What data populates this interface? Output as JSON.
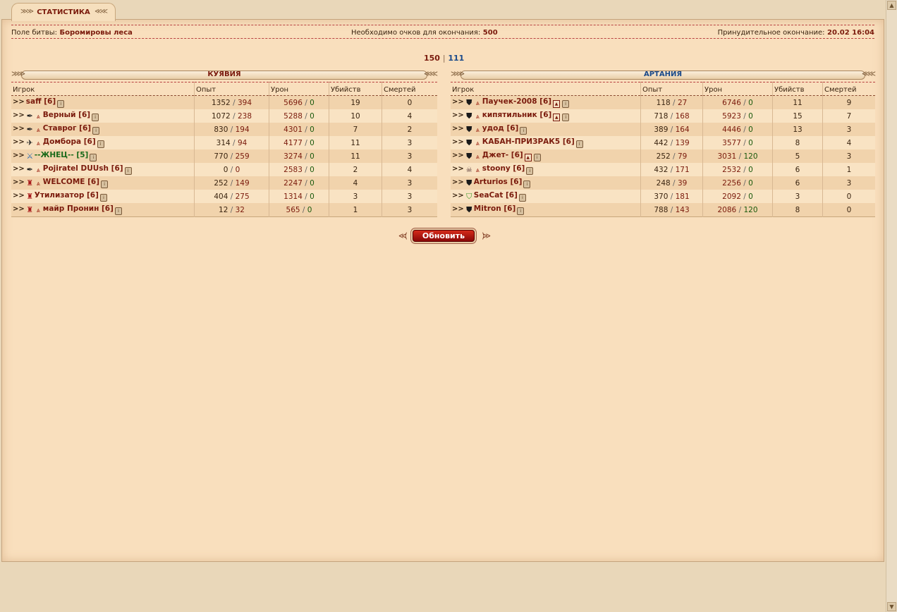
{
  "tab": {
    "label": "СТАТИСТИКА"
  },
  "info": {
    "battlefield_label": "Поле битвы:",
    "battlefield_value": "Боромировы леса",
    "points_label": "Необходимо очков для окончания:",
    "points_value": "500",
    "forced_end_label": "Принудительное окончание:",
    "forced_end_value": "20.02 16:04"
  },
  "score": {
    "left": "150",
    "sep": "|",
    "right": "111"
  },
  "columns": {
    "player": "Игрок",
    "exp": "Опыт",
    "damage": "Урон",
    "kills": "Убийств",
    "deaths": "Смертей"
  },
  "teams": [
    {
      "name": "КУЯВИЯ",
      "color": "#7a1a0c",
      "rows": [
        {
          "icons": [],
          "name": "saff [6]",
          "exp_a": "1352",
          "exp_b": "394",
          "dmg_a": "5696",
          "dmg_b": "0",
          "kills": "19",
          "deaths": "0"
        },
        {
          "icons": [
            "pen-icon",
            "rank-icon"
          ],
          "name": "Верный [6]",
          "exp_a": "1072",
          "exp_b": "238",
          "dmg_a": "5288",
          "dmg_b": "0",
          "kills": "10",
          "deaths": "4"
        },
        {
          "icons": [
            "pen-icon",
            "rank-icon"
          ],
          "name": "Ставрог [6]",
          "exp_a": "830",
          "exp_b": "194",
          "dmg_a": "4301",
          "dmg_b": "0",
          "kills": "7",
          "deaths": "2"
        },
        {
          "icons": [
            "bird-icon",
            "rank-icon"
          ],
          "name": "Домбора [6]",
          "exp_a": "314",
          "exp_b": "94",
          "dmg_a": "4177",
          "dmg_b": "0",
          "kills": "11",
          "deaths": "3"
        },
        {
          "icons": [
            "crossed-swords-icon"
          ],
          "name": "--ЖНЕЦ-- [5]",
          "green": true,
          "exp_a": "770",
          "exp_b": "259",
          "dmg_a": "3274",
          "dmg_b": "0",
          "kills": "11",
          "deaths": "3"
        },
        {
          "icons": [
            "pen-icon",
            "rank-icon"
          ],
          "name": "Pojiratel DUUsh [6]",
          "exp_a": "0",
          "exp_b": "0",
          "dmg_a": "2583",
          "dmg_b": "0",
          "kills": "2",
          "deaths": "4"
        },
        {
          "icons": [
            "helmet-icon",
            "rank-icon"
          ],
          "name": "WELCOME [6]",
          "exp_a": "252",
          "exp_b": "149",
          "dmg_a": "2247",
          "dmg_b": "0",
          "kills": "4",
          "deaths": "3"
        },
        {
          "icons": [
            "helmet-icon"
          ],
          "name": "Утилизатор [6]",
          "exp_a": "404",
          "exp_b": "275",
          "dmg_a": "1314",
          "dmg_b": "0",
          "kills": "3",
          "deaths": "3"
        },
        {
          "icons": [
            "helmet-icon",
            "rank-icon"
          ],
          "name": "майр Пронин [6]",
          "exp_a": "12",
          "exp_b": "32",
          "dmg_a": "565",
          "dmg_b": "0",
          "kills": "1",
          "deaths": "3"
        }
      ]
    },
    {
      "name": "АРТАНИЯ",
      "color": "#1a4a8a",
      "rows": [
        {
          "icons": [
            "shield-icon",
            "rank-icon"
          ],
          "name": "Паучек-2008 [6]",
          "flag": true,
          "exp_a": "118",
          "exp_b": "27",
          "dmg_a": "6746",
          "dmg_b": "0",
          "kills": "11",
          "deaths": "9"
        },
        {
          "icons": [
            "shield-icon",
            "rank-icon"
          ],
          "name": "кипятильник [6]",
          "flag": true,
          "exp_a": "718",
          "exp_b": "168",
          "dmg_a": "5923",
          "dmg_b": "0",
          "kills": "15",
          "deaths": "7"
        },
        {
          "icons": [
            "shield-icon",
            "rank-icon"
          ],
          "name": "удод [6]",
          "exp_a": "389",
          "exp_b": "164",
          "dmg_a": "4446",
          "dmg_b": "0",
          "kills": "13",
          "deaths": "3"
        },
        {
          "icons": [
            "shield-icon",
            "rank-icon"
          ],
          "name": "КАБАН-ПРИЗРАК5 [6]",
          "exp_a": "442",
          "exp_b": "139",
          "dmg_a": "3577",
          "dmg_b": "0",
          "kills": "8",
          "deaths": "4"
        },
        {
          "icons": [
            "shield-icon",
            "rank-icon"
          ],
          "name": "Джет- [6]",
          "flag": true,
          "exp_a": "252",
          "exp_b": "79",
          "dmg_a": "3031",
          "dmg_b": "120",
          "kills": "5",
          "deaths": "3"
        },
        {
          "icons": [
            "skull-icon",
            "rank-icon"
          ],
          "name": "stoony [6]",
          "exp_a": "432",
          "exp_b": "171",
          "dmg_a": "2532",
          "dmg_b": "0",
          "kills": "6",
          "deaths": "1"
        },
        {
          "icons": [
            "shield-icon"
          ],
          "name": "Arturios [6]",
          "exp_a": "248",
          "exp_b": "39",
          "dmg_a": "2256",
          "dmg_b": "0",
          "kills": "6",
          "deaths": "3"
        },
        {
          "icons": [
            "green-shield-icon"
          ],
          "name": "SeaCat [6]",
          "exp_a": "370",
          "exp_b": "181",
          "dmg_a": "2092",
          "dmg_b": "0",
          "kills": "3",
          "deaths": "0"
        },
        {
          "icons": [
            "shield-icon"
          ],
          "name": "Mitron [6]",
          "exp_a": "788",
          "exp_b": "143",
          "dmg_a": "2086",
          "dmg_b": "120",
          "kills": "8",
          "deaths": "0"
        }
      ]
    }
  ],
  "refresh": {
    "label": "Обновить"
  }
}
